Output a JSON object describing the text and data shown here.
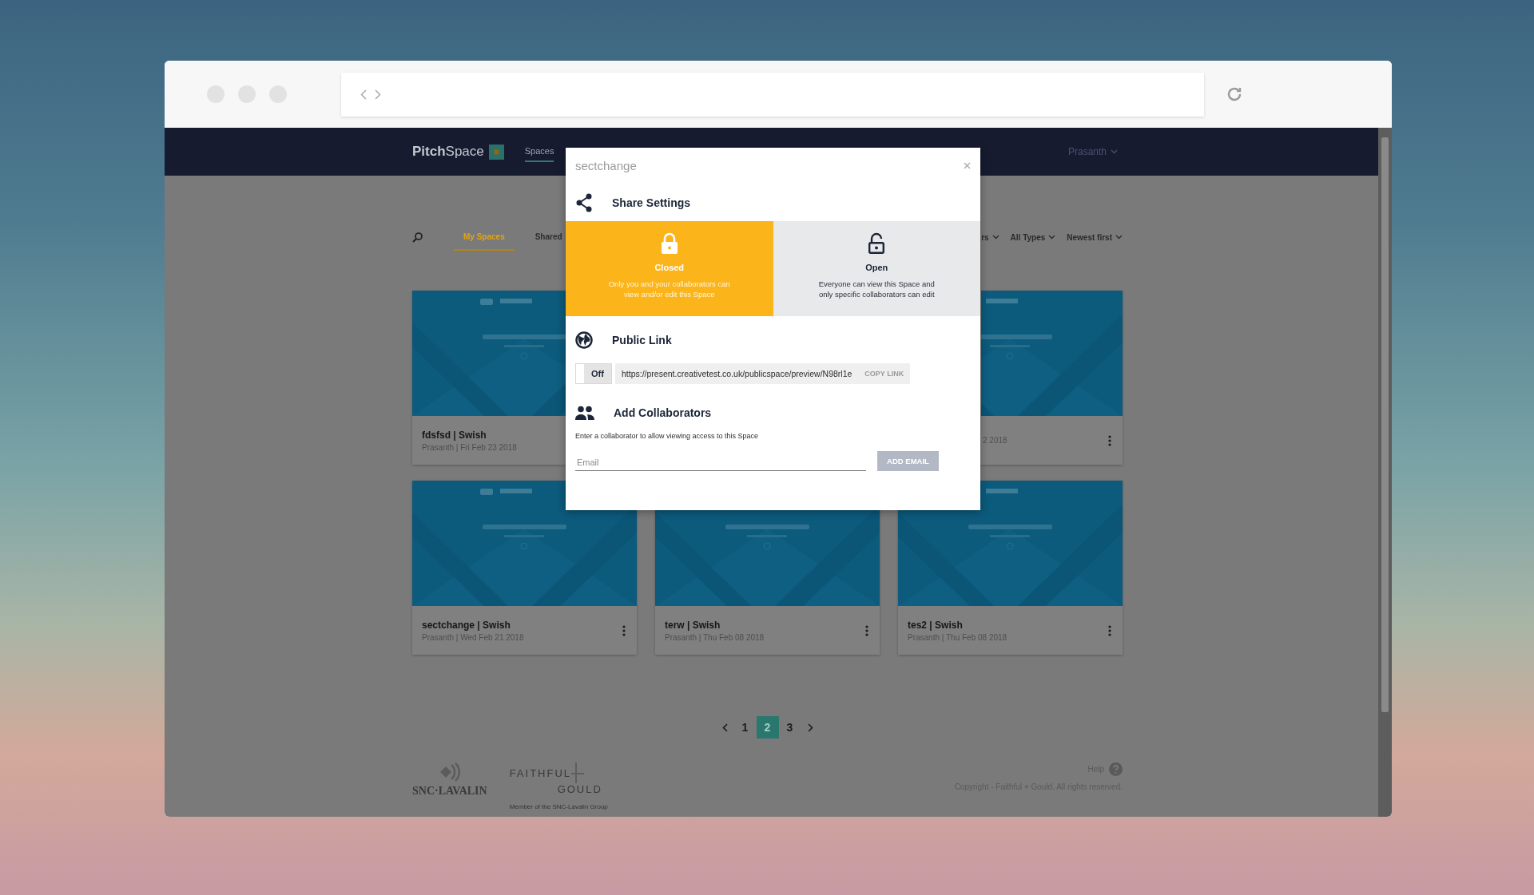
{
  "header": {
    "logo": {
      "first": "Pitch",
      "second": "Space"
    },
    "nav": [
      {
        "label": "Spaces",
        "selected": true
      }
    ],
    "user": "Prasanth"
  },
  "filters": {
    "tabs": [
      {
        "label": "My Spaces",
        "selected": true
      },
      {
        "label": "Shared",
        "selected": false
      }
    ],
    "dropdowns": [
      "rs",
      "All Types",
      "Newest first"
    ]
  },
  "cards": [
    {
      "kind": "left",
      "title": "fdsfsd | Swish",
      "meta": "Prasanth | Fri Feb 23 2018"
    },
    {
      "kind": "covered"
    },
    {
      "kind": "right",
      "meta": "2 2018"
    },
    {
      "kind": "full",
      "title": "sectchange | Swish",
      "meta": "Prasanth | Wed Feb 21 2018"
    },
    {
      "kind": "full",
      "title": "terw | Swish",
      "meta": "Prasanth | Thu Feb 08 2018"
    },
    {
      "kind": "full",
      "title": "tes2 | Swish",
      "meta": "Prasanth | Thu Feb 08 2018"
    }
  ],
  "pagination": {
    "pages": [
      {
        "label": "1",
        "selected": false
      },
      {
        "label": "2",
        "selected": true
      },
      {
        "label": "3",
        "selected": false
      }
    ]
  },
  "footer": {
    "logo_left": "SNC·LAVALIN",
    "logo_right_top": "FAITHFUL",
    "logo_right_bottom": "GOULD",
    "tagline": "Member of the SNC-Lavalin Group",
    "help": "Help",
    "copyright": "Copyright - Faithful + Gould. All rights reserved."
  },
  "modal": {
    "title": "sectchange",
    "share": {
      "heading": "Share Settings",
      "options": [
        {
          "kind": "closed",
          "label": "Closed",
          "text": "Only you and your collaborators can view and/or edit this Space",
          "selected": true
        },
        {
          "kind": "open",
          "label": "Open",
          "text": "Everyone can view this Space and only specific collaborators can edit",
          "selected": false
        }
      ]
    },
    "public_link": {
      "heading": "Public Link",
      "toggle": {
        "label": "Off",
        "on": false
      },
      "url": "https://present.creativetest.co.uk/publicspace/preview/N98rl1e",
      "copy": {
        "label": "COPY LINK",
        "disabled": true
      }
    },
    "collaborators": {
      "heading": "Add Collaborators",
      "hint": "Enter a collaborator to allow viewing access to this Space",
      "email": {
        "placeholder": "Email"
      },
      "button": "ADD EMAIL"
    }
  }
}
